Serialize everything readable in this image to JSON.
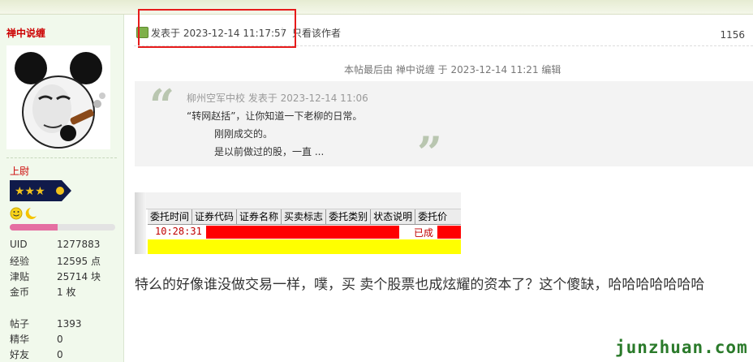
{
  "user": {
    "name": "禅中说缠",
    "rank": "上尉",
    "level_progress": 0.45,
    "stats": [
      {
        "label": "UID",
        "value": "1277883"
      },
      {
        "label": "经验",
        "value": "12595 点"
      },
      {
        "label": "津贴",
        "value": "25714 块"
      },
      {
        "label": "金币",
        "value": "1 枚"
      },
      {
        "label": "帖子",
        "value": "1393"
      },
      {
        "label": "精华",
        "value": "0"
      },
      {
        "label": "好友",
        "value": "0"
      }
    ]
  },
  "post": {
    "posted_at": "发表于 2023-12-14 11:17:57",
    "separator": "|",
    "view_author": "只看该作者",
    "floor": "1156",
    "edit_note": "本帖最后由 禅中说缠 于 2023-12-14 11:21 编辑",
    "quote": {
      "author_line": "柳州空军中校 发表于 2023-12-14 11:06",
      "lines": [
        "“转网赵括”，让你知道一下老柳的日常。",
        "刚刚成交的。",
        "是以前做过的股，一直 ..."
      ]
    },
    "screenshot": {
      "headers": [
        "委托时间",
        "证券代码",
        "证券名称",
        "买卖标志",
        "委托类别",
        "状态说明",
        "委托价"
      ],
      "time": "10:28:31",
      "status": "已成"
    },
    "body": "特么的好像谁没做交易一样，噗，买 卖个股票也成炫耀的资本了？这个傻缺，哈哈哈哈哈哈哈"
  },
  "watermark": "junzhuan.com",
  "colors": {
    "accent_red": "#cc0000",
    "highlight_box": "#e61b1b",
    "sidebar_bg": "#f1f9ec",
    "watermark": "#2a7a2a"
  },
  "icons": [
    "post-icon",
    "avatar-panda-meme",
    "rank-stars-icon",
    "smile-emoji-icon",
    "moon-emoji-icon"
  ]
}
